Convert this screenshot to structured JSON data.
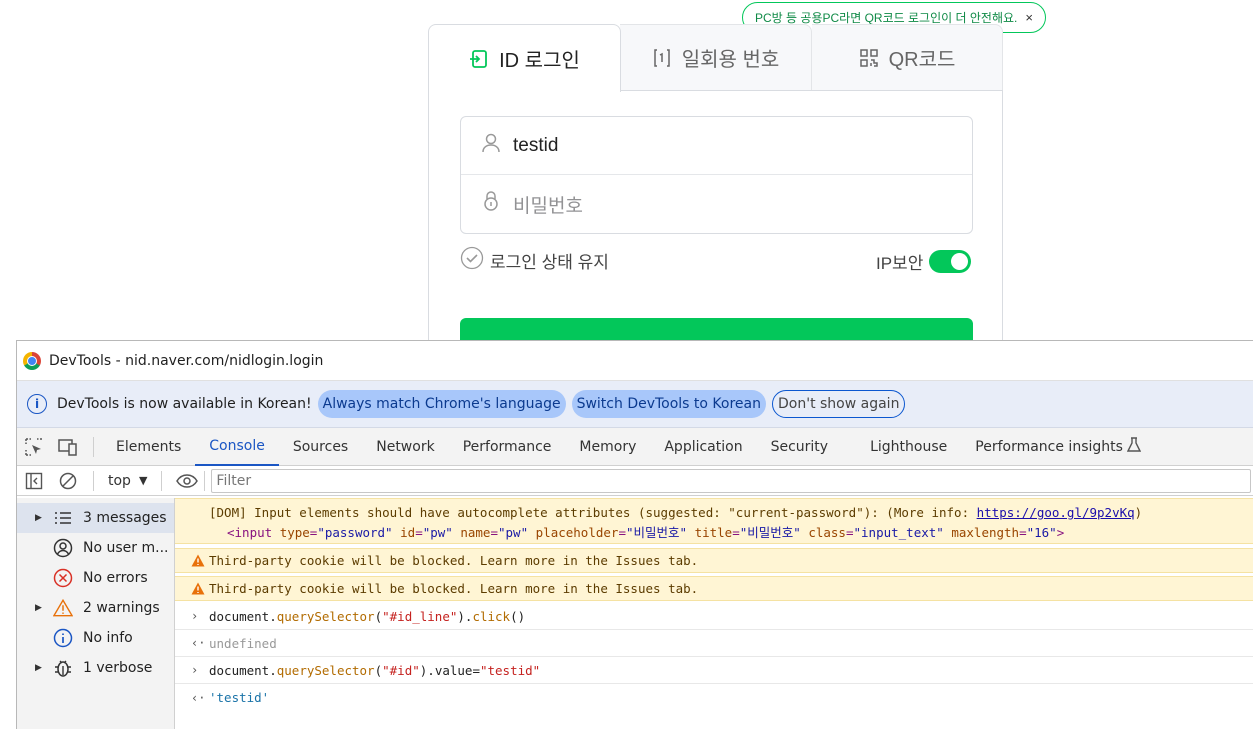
{
  "login": {
    "qr_tip": "PC방 등 공용PC라면 QR코드 로그인이 더 안전해요.",
    "tabs": [
      {
        "label": "ID 로그인",
        "icon": "login-icon"
      },
      {
        "label": "일회용 번호",
        "icon": "otp-icon"
      },
      {
        "label": "QR코드",
        "icon": "qr-icon"
      }
    ],
    "id_value": "testid",
    "password_placeholder": "비밀번호",
    "keep_login_label": "로그인 상태 유지",
    "ip_security_label": "IP보안",
    "ip_security_on": true,
    "brand_color": "#03c75a"
  },
  "devtools": {
    "window_title": "DevTools - nid.naver.com/nidlogin.login",
    "infobar": {
      "message": "DevTools is now available in Korean!",
      "btn_match": "Always match Chrome's language",
      "btn_switch": "Switch DevTools to Korean",
      "btn_dismiss": "Don't show again"
    },
    "tabs": [
      "Elements",
      "Console",
      "Sources",
      "Network",
      "Performance",
      "Memory",
      "Application",
      "Security",
      "Lighthouse",
      "Performance insights"
    ],
    "active_tab": "Console",
    "context": "top",
    "filter_placeholder": "Filter",
    "sidebar": [
      {
        "label": "3 messages",
        "icon": "list-icon",
        "expandable": true
      },
      {
        "label": "No user m...",
        "icon": "user-icon",
        "expandable": false
      },
      {
        "label": "No errors",
        "icon": "error-icon",
        "expandable": false
      },
      {
        "label": "2 warnings",
        "icon": "warning-icon",
        "expandable": true
      },
      {
        "label": "No info",
        "icon": "info-icon",
        "expandable": false
      },
      {
        "label": "1 verbose",
        "icon": "bug-icon",
        "expandable": true
      }
    ],
    "console": {
      "dom_msg_line1": "[DOM] Input elements should have autocomplete attributes (suggested: \"current-password\"): (More info: ",
      "dom_msg_link": "https://goo.gl/9p2vKq",
      "dom_msg_close": ")",
      "dom_msg_line2": {
        "open": "<input ",
        "a1": "type",
        "v1": "\"password\"",
        "a2": "id",
        "v2": "\"pw\"",
        "a3": "name",
        "v3": "\"pw\"",
        "a4": "placeholder",
        "v4": "\"비밀번호\"",
        "a5": "title",
        "v5": "\"비밀번호\"",
        "a6": "class",
        "v6": "\"input_text\"",
        "a7": "maxlength",
        "v7": "\"16\"",
        "close": ">"
      },
      "warning1": "Third-party cookie will be blocked. Learn more in the Issues tab.",
      "warning2": "Third-party cookie will be blocked. Learn more in the Issues tab.",
      "cmd1": {
        "obj": "document",
        "fn": "querySelector",
        "arg": "\"#id_line\"",
        "fn2": "click",
        "tail": "()"
      },
      "res1": "undefined",
      "cmd2": {
        "obj": "document",
        "fn": "querySelector",
        "arg": "\"#id\"",
        "prop": ").value= ",
        "val": "\"testid\""
      },
      "res2": "'testid'"
    }
  }
}
